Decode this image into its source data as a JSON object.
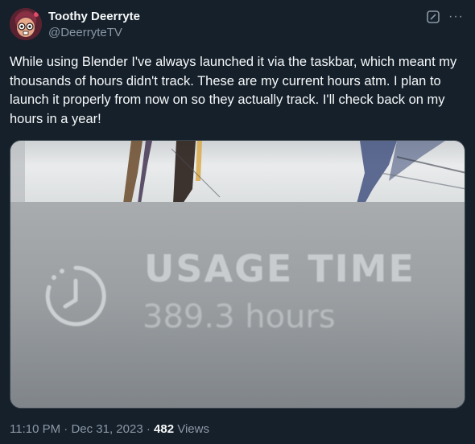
{
  "author": {
    "display_name": "Toothy Deerryte",
    "handle": "@DeerryteTV"
  },
  "top_actions": {
    "grok_icon": "grok-icon",
    "more_icon": "more-icon",
    "more_glyph": "···"
  },
  "tweet": {
    "text": "While using Blender I've always launched it via the taskbar, which meant my thousands of hours didn't track. These are my current hours atm. I plan to launch it properly from now on so they actually track. I'll check back on my hours in a year!"
  },
  "media": {
    "usage_label": "USAGE TIME",
    "usage_value": "389.3 hours",
    "icon": "clock-icon"
  },
  "meta": {
    "time": "11:10 PM",
    "separator1": " · ",
    "date": "Dec 31, 2023",
    "separator2": " · ",
    "views_count": "482",
    "views_label": " Views"
  },
  "colors": {
    "background": "#15202b",
    "secondary_text": "#8b98a5",
    "primary_text": "#f7f9f9"
  }
}
